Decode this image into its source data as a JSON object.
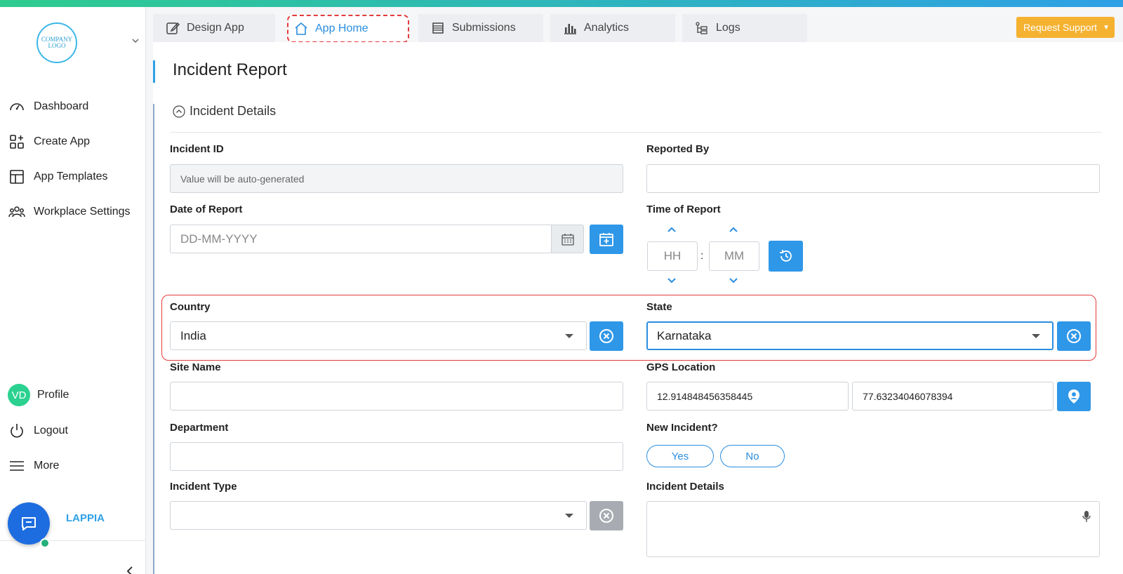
{
  "sidebar": {
    "logo_text": "COMPANY LOGO",
    "nav": [
      {
        "label": "Dashboard",
        "icon": "gauge-icon"
      },
      {
        "label": "Create App",
        "icon": "grid-plus-icon"
      },
      {
        "label": "App Templates",
        "icon": "template-icon"
      },
      {
        "label": "Workplace Settings",
        "icon": "users-icon"
      }
    ],
    "profile": {
      "initials": "VD",
      "label": "Profile"
    },
    "logout_label": "Logout",
    "more_label": "More",
    "brand_label": "LAPPIA"
  },
  "tabs": [
    {
      "label": "Design App",
      "icon": "edit-icon"
    },
    {
      "label": "App Home",
      "icon": "home-icon"
    },
    {
      "label": "Submissions",
      "icon": "list-icon"
    },
    {
      "label": "Analytics",
      "icon": "bar-chart-icon"
    },
    {
      "label": "Logs",
      "icon": "logs-icon"
    }
  ],
  "request_support": "Request Support",
  "page_title": "Incident Report",
  "section_title": "Incident Details",
  "fields": {
    "incident_id": {
      "label": "Incident ID",
      "value": "Value will be auto-generated"
    },
    "reported_by": {
      "label": "Reported By",
      "value": ""
    },
    "date_of_report": {
      "label": "Date of Report",
      "placeholder": "DD-MM-YYYY"
    },
    "time_of_report": {
      "label": "Time of Report",
      "hh": "HH",
      "mm": "MM",
      "sep": ":"
    },
    "country": {
      "label": "Country",
      "value": "India"
    },
    "state": {
      "label": "State",
      "value": "Karnataka"
    },
    "site_name": {
      "label": "Site Name",
      "value": ""
    },
    "gps_location": {
      "label": "GPS Location",
      "lat": "12.914848456358445",
      "lng": "77.63234046078394"
    },
    "department": {
      "label": "Department",
      "value": ""
    },
    "new_incident": {
      "label": "New Incident?",
      "options": [
        "Yes",
        "No"
      ]
    },
    "incident_type": {
      "label": "Incident Type",
      "value": ""
    },
    "incident_details": {
      "label": "Incident Details",
      "value": ""
    }
  },
  "colors": {
    "accent": "#2f97e8",
    "highlight": "#e43b3b",
    "support": "#f5b130",
    "avatar": "#2bd18f"
  }
}
